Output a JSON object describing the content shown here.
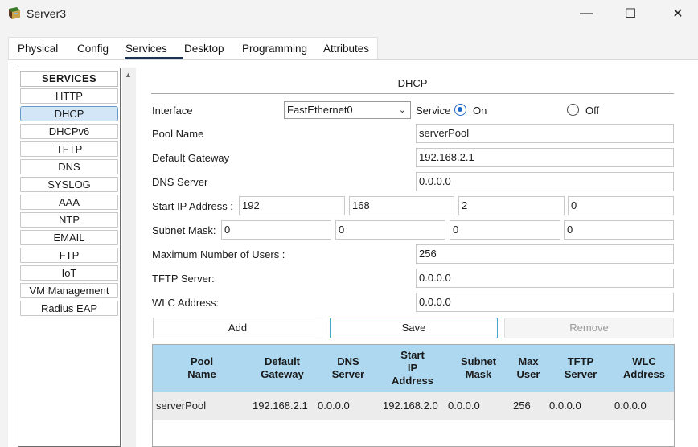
{
  "window": {
    "title": "Server3",
    "minimize": "—",
    "maximize": "☐",
    "close": "✕"
  },
  "tabs": [
    "Physical",
    "Config",
    "Services",
    "Desktop",
    "Programming",
    "Attributes"
  ],
  "active_tab": "Services",
  "sidebar": {
    "header": "SERVICES",
    "items": [
      "HTTP",
      "DHCP",
      "DHCPv6",
      "TFTP",
      "DNS",
      "SYSLOG",
      "AAA",
      "NTP",
      "EMAIL",
      "FTP",
      "IoT",
      "VM Management",
      "Radius EAP"
    ],
    "selected": "DHCP"
  },
  "dhcp": {
    "title": "DHCP",
    "interface_label": "Interface",
    "interface_value": "FastEthernet0",
    "service_label": "Service",
    "on_label": "On",
    "off_label": "Off",
    "service_state": "On",
    "pool_name_label": "Pool Name",
    "pool_name_value": "serverPool",
    "gateway_label": "Default Gateway",
    "gateway_value": "192.168.2.1",
    "dns_label": "DNS Server",
    "dns_value": "0.0.0.0",
    "start_ip_label": "Start IP Address :",
    "start_ip": [
      "192",
      "168",
      "2",
      "0"
    ],
    "subnet_label": "Subnet Mask:",
    "subnet": [
      "0",
      "0",
      "0",
      "0"
    ],
    "max_users_label": "Maximum Number of Users :",
    "max_users_value": "256",
    "tftp_label": "TFTP Server:",
    "tftp_value": "0.0.0.0",
    "wlc_label": "WLC Address:",
    "wlc_value": "0.0.0.0",
    "add_label": "Add",
    "save_label": "Save",
    "remove_label": "Remove"
  },
  "table": {
    "headers": [
      [
        "Pool",
        "Name"
      ],
      [
        "Default",
        "Gateway"
      ],
      [
        "DNS",
        "Server"
      ],
      [
        "Start",
        "IP",
        "Address"
      ],
      [
        "Subnet",
        "Mask"
      ],
      [
        "Max",
        "User"
      ],
      [
        "TFTP",
        "Server"
      ],
      [
        "WLC",
        "Address"
      ]
    ],
    "rows": [
      [
        "serverPool",
        "192.168.2.1",
        "0.0.0.0",
        "192.168.2.0",
        "0.0.0.0",
        "256",
        "0.0.0.0",
        "0.0.0.0"
      ]
    ]
  },
  "colors": {
    "accent_radio": "#1e66c8",
    "table_header": "#add8f0",
    "selected_item": "#d3e6f7"
  }
}
